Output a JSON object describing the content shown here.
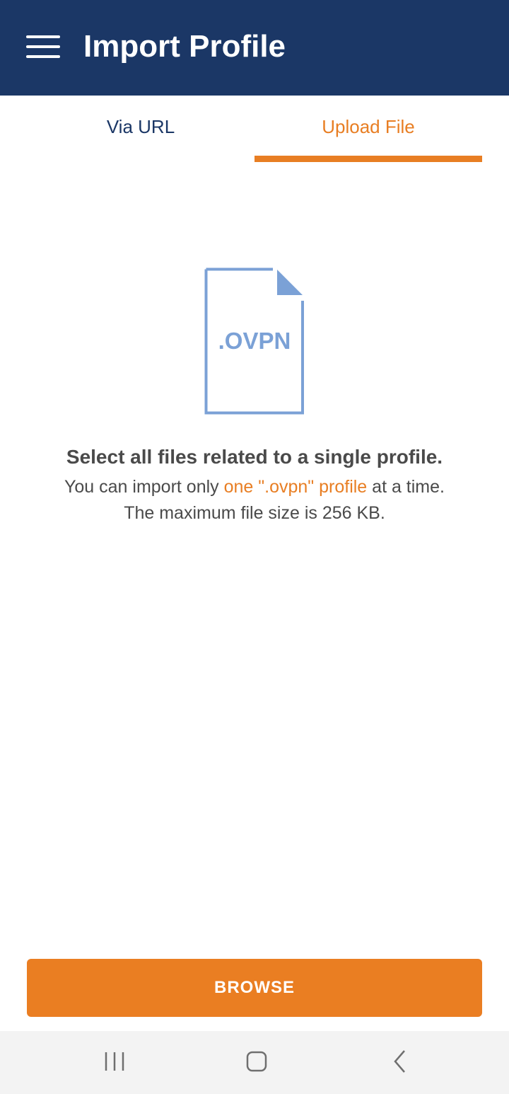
{
  "app_bar": {
    "title": "Import Profile",
    "menu_icon": "hamburger-menu-icon",
    "background_color": "#1b3766"
  },
  "tabs": [
    {
      "label": "Via URL",
      "selected": false
    },
    {
      "label": "Upload File",
      "selected": true
    }
  ],
  "content": {
    "file_icon": "ovpn-file-icon",
    "file_extension": ".OVPN",
    "heading": "Select all files related to a single profile.",
    "line2_prefix": "You can import only ",
    "line2_highlight": "one \".ovpn\" profile",
    "line2_suffix": " at a time.",
    "line3": "The maximum file size is 256 KB."
  },
  "browse_button": {
    "label": "BROWSE"
  },
  "system_nav": {
    "recents_icon": "recent-apps-icon",
    "home_icon": "home-icon",
    "back_icon": "back-icon"
  },
  "colors": {
    "accent": "#e87e23",
    "primary": "#1b3766",
    "file_icon": "#7ba1d6",
    "text": "#4a4a4a"
  }
}
